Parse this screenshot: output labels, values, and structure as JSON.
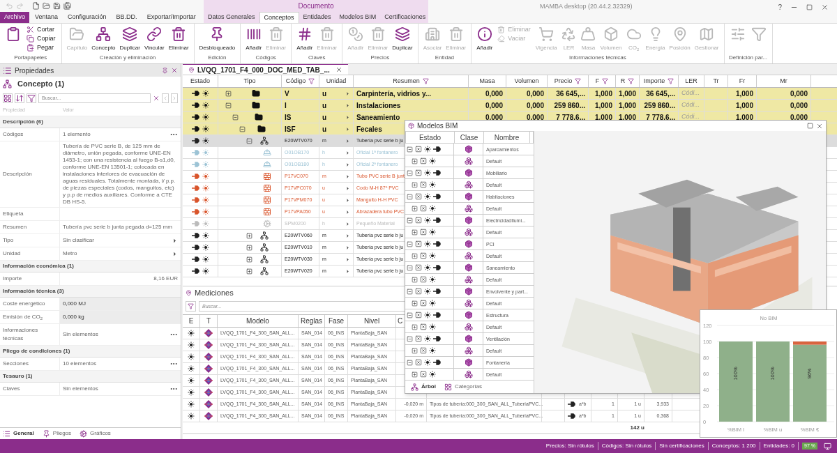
{
  "title_bar": {
    "title": "MAMBA desktop (20.44.2.32329)",
    "help": "?"
  },
  "context_group": {
    "label": "Documento"
  },
  "tabs": [
    {
      "label": "Archivo",
      "kind": "file",
      "selected": false
    },
    {
      "label": "Ventana",
      "kind": "plain",
      "selected": false
    },
    {
      "label": "Configuración",
      "kind": "plain",
      "selected": false
    },
    {
      "label": "BB.DD.",
      "kind": "plain",
      "selected": false
    },
    {
      "label": "Exportar/Importar",
      "kind": "plain",
      "selected": false
    },
    {
      "label": "Datos Generales",
      "kind": "context",
      "selected": false
    },
    {
      "label": "Conceptos",
      "kind": "context",
      "selected": true
    },
    {
      "label": "Entidades",
      "kind": "context",
      "selected": false
    },
    {
      "label": "Modelos BIM",
      "kind": "context",
      "selected": false
    },
    {
      "label": "Certificaciones",
      "kind": "context",
      "selected": false
    }
  ],
  "ribbon": [
    {
      "label": "Portapapeles",
      "buttons": [
        {
          "kind": "icon",
          "disabled": false
        },
        {
          "kind": "small",
          "label": "Cortar",
          "disabled": false
        },
        {
          "kind": "small",
          "label": "Copiar",
          "disabled": false
        },
        {
          "kind": "small",
          "label": "Pegar",
          "disabled": false
        }
      ]
    },
    {
      "label": "Creación y eliminación",
      "buttons": [
        {
          "kind": "large",
          "label": "Capítulo",
          "disabled": true
        },
        {
          "kind": "large",
          "label": "Concepto",
          "disabled": false
        },
        {
          "kind": "large",
          "label": "Duplicar",
          "disabled": false
        },
        {
          "kind": "large",
          "label": "Vincular",
          "disabled": false
        },
        {
          "kind": "large",
          "label": "Eliminar",
          "disabled": false
        }
      ]
    },
    {
      "label": "Edición",
      "buttons": [
        {
          "kind": "large",
          "label": "Desbloqueado",
          "disabled": false
        }
      ]
    },
    {
      "label": "Códigos",
      "buttons": [
        {
          "kind": "large",
          "label": "Añadir",
          "disabled": false
        },
        {
          "kind": "large",
          "label": "Eliminar",
          "disabled": true
        }
      ]
    },
    {
      "label": "Claves",
      "buttons": [
        {
          "kind": "large",
          "label": "Añadir",
          "disabled": false
        },
        {
          "kind": "large",
          "label": "Eliminar",
          "disabled": true
        }
      ]
    },
    {
      "label": "Precios",
      "buttons": [
        {
          "kind": "large",
          "label": "Añadir",
          "disabled": true
        },
        {
          "kind": "large",
          "label": "Eliminar",
          "disabled": true
        },
        {
          "kind": "large",
          "label": "Duplicar",
          "disabled": false
        }
      ]
    },
    {
      "label": "Entidad",
      "buttons": [
        {
          "kind": "large",
          "label": "Asociar",
          "disabled": true
        },
        {
          "kind": "large",
          "label": "Eliminar",
          "disabled": true
        }
      ]
    },
    {
      "label": "Informaciones técnicas",
      "buttons": [
        {
          "kind": "large",
          "label": "Añadir",
          "disabled": false
        },
        {
          "kind": "small",
          "label": "Eliminar",
          "disabled": true
        },
        {
          "kind": "small",
          "label": "Vaciar",
          "disabled": true
        },
        {
          "kind": "large",
          "label": "Vigencia",
          "disabled": true
        },
        {
          "kind": "large",
          "label": "LER",
          "disabled": true
        },
        {
          "kind": "large",
          "label": "Masa",
          "disabled": true
        },
        {
          "kind": "large",
          "label": "Volumen",
          "disabled": true
        },
        {
          "kind": "large",
          "label": "CO$_{2}$",
          "disabled": true
        },
        {
          "kind": "large",
          "label": "Energía",
          "disabled": true
        },
        {
          "kind": "large",
          "label": "Posición",
          "disabled": true
        },
        {
          "kind": "large",
          "label": "Gestionar",
          "disabled": true
        }
      ]
    },
    {
      "label": "Definición par...",
      "buttons": [
        {
          "kind": "icon",
          "disabled": true
        },
        {
          "kind": "icon",
          "disabled": true
        }
      ]
    }
  ],
  "properties_panel": {
    "title": "Propiedades",
    "concept": "Concepto (1)",
    "search_placeholder": "Buscar...",
    "columns": [
      "Propiedad",
      "Valor"
    ],
    "sections": [
      {
        "title": "Descripción (6)",
        "rows": [
          {
            "label": "Códigos",
            "value": "1 elemento",
            "kind": "list"
          },
          {
            "label": "Descripción",
            "value": "Tubería de PVC serie B, de 125 mm de diámetro, unión pegada, conforme UNE-EN 1453-1; con una resistencia al fuego B-s1,d0, conforme UNE-EN 13501-1; colocada en instalaciones interiores de evacuación de aguas residuales. Totalmente montada, i/ p.p. de piezas especiales (codos, manguitos, etc) y p.p de medios auxiliares. Conforme a CTE DB HS-5.",
            "kind": "text"
          },
          {
            "label": "Etiqueta",
            "kind": "text"
          },
          {
            "label": "Resumen",
            "value": "Tubería pvc serie b junta pegada d=125 mm",
            "kind": "text"
          },
          {
            "label": "Tipo",
            "value": "Sin clasificar",
            "kind": "choice"
          },
          {
            "label": "Unidad",
            "value": "Metro",
            "kind": "choice"
          }
        ]
      },
      {
        "title": "Información económica (1)",
        "rows": [
          {
            "label": "Importe",
            "value": "8,16 EUR",
            "kind": "amount"
          }
        ]
      },
      {
        "title": "Información técnica (3)",
        "rows": [
          {
            "label": "Coste energético",
            "value": "0,000 MJ",
            "kind": "computed"
          },
          {
            "label": "Emisión de CO$_{2}$",
            "value": "0,000 kg",
            "kind": "computed"
          },
          {
            "label": "Informaciones técnicas",
            "value": "Sin elementos",
            "kind": "list"
          }
        ]
      },
      {
        "title": "Pliego de condiciones (1)",
        "rows": [
          {
            "label": "Secciones",
            "value": "10 elementos",
            "kind": "list"
          }
        ]
      },
      {
        "title": "Tesauro (1)",
        "rows": [
          {
            "label": "Claves",
            "value": "Sin elementos",
            "kind": "list"
          }
        ]
      }
    ],
    "tabs": [
      {
        "label": "General",
        "selected": true
      },
      {
        "label": "Pliegos",
        "selected": false
      },
      {
        "label": "Gráficos",
        "selected": false
      }
    ]
  },
  "document_tab": {
    "label": "LVQQ_1701_F4_000_DOC_MED_TAB_..."
  },
  "concepts_table": {
    "columns": [
      {
        "label": "Estado",
        "filter": false
      },
      {
        "label": "Tipo",
        "filter": false
      },
      {
        "label": "Código",
        "filter": true
      },
      {
        "label": "Unidad",
        "filter": false
      },
      {
        "label": "Resumen",
        "filter": true
      },
      {
        "label": "Masa",
        "filter": false
      },
      {
        "label": "Volumen",
        "filter": false
      },
      {
        "label": "Precio",
        "filter": true
      },
      {
        "label": "F",
        "filter": true
      },
      {
        "label": "R",
        "filter": true
      },
      {
        "label": "Importe",
        "filter": true
      },
      {
        "label": "LER",
        "filter": false
      },
      {
        "label": "Tr",
        "filter": false
      },
      {
        "label": "Fr",
        "filter": false
      },
      {
        "label": "Mr",
        "filter": false
      }
    ],
    "rows": [
      {
        "kind": "chapter",
        "selected": false,
        "expanded": false,
        "code": "V",
        "unit": "u",
        "summary": "Carpintería, vidrios y...",
        "masa": "0,000",
        "volumen": "0,000",
        "precio": "36 645,...",
        "f": "1,000",
        "r": "1,000",
        "importe": "36 645,...",
        "ler": "Códi...",
        "fr": "1,000",
        "mr": "0,000"
      },
      {
        "kind": "chapter",
        "selected": false,
        "expanded": true,
        "code": "I",
        "unit": "u",
        "summary": "Instalaciones",
        "masa": "0,000",
        "volumen": "0,000",
        "precio": "259 860...",
        "f": "1,000",
        "r": "1,000",
        "importe": "259 860...",
        "ler": "Códi...",
        "fr": "1,000",
        "mr": "0,000",
        "children": [
          {
            "kind": "chapter",
            "selected": false,
            "expanded": true,
            "code": "IS",
            "unit": "u",
            "summary": "Saneamiento",
            "masa": "0,000",
            "volumen": "0,000",
            "precio": "7 778,6...",
            "f": "1,000",
            "r": "1,000",
            "importe": "7 778,6...",
            "ler": "Códi...",
            "fr": "1,000",
            "mr": "0,000",
            "children": [
              {
                "kind": "chapter",
                "selected": false,
                "expanded": true,
                "code": "ISF",
                "unit": "u",
                "summary": "Fecales",
                "children": [
                  {
                    "kind": "item",
                    "selected": true,
                    "expanded": true,
                    "code": "E20WTV070",
                    "unit": "m",
                    "summary": "Tubería pvc serie b ju",
                    "children": [
                      {
                        "kind": "labour",
                        "selected": false,
                        "code": "O01OB170",
                        "unit": "h",
                        "summary": "Oficial 1ª fontanero"
                      },
                      {
                        "kind": "labour",
                        "selected": false,
                        "code": "O01OB180",
                        "unit": "h",
                        "summary": "Oficial 2ª fontanero"
                      },
                      {
                        "kind": "material",
                        "selected": false,
                        "code": "P17VC070",
                        "unit": "m",
                        "summary": "Tubo PVC serie B junt"
                      },
                      {
                        "kind": "material",
                        "selected": false,
                        "code": "P17VPC070",
                        "unit": "u",
                        "summary": "Codo M-H 87º PVC"
                      },
                      {
                        "kind": "material",
                        "selected": false,
                        "code": "P17VPM070",
                        "unit": "u",
                        "summary": "Manguito H-H PVC"
                      },
                      {
                        "kind": "material",
                        "selected": false,
                        "code": "P17VPA050",
                        "unit": "u",
                        "summary": "Abrazadera tubo PVC"
                      },
                      {
                        "kind": "other",
                        "selected": false,
                        "code": "SPM0200",
                        "unit": "h",
                        "summary": "Pequeño Material"
                      }
                    ]
                  },
                  {
                    "kind": "item",
                    "selected": false,
                    "expanded": false,
                    "code": "E20WTV060",
                    "unit": "m",
                    "summary": "Tubería pvc serie b ju"
                  },
                  {
                    "kind": "item",
                    "selected": false,
                    "expanded": false,
                    "code": "E20WTV010",
                    "unit": "m",
                    "summary": "Tubería pvc serie b ju"
                  },
                  {
                    "kind": "item",
                    "selected": false,
                    "expanded": false,
                    "code": "E20WTV030",
                    "unit": "m",
                    "summary": "Tubería pvc serie b ju"
                  },
                  {
                    "kind": "item",
                    "selected": false,
                    "expanded": false,
                    "code": "E20WTV020",
                    "unit": "m",
                    "summary": "Tubería pvc serie b ju"
                  }
                ]
              }
            ]
          }
        ]
      }
    ]
  },
  "mediciones": {
    "title": "Mediciones",
    "search_placeholder": "Buscar...",
    "columns": [
      "E",
      "T",
      "Modelo",
      "Reglas",
      "Fase",
      "Nivel",
      "C"
    ],
    "rows": [
      {
        "modelo": "LVQQ_1701_F4_300_SAN_ALL...",
        "reglas": "SAN_014",
        "fase": "06_INS",
        "nivel": "PlantaBaja_SAN"
      },
      {
        "modelo": "LVQQ_1701_F4_300_SAN_ALL...",
        "reglas": "SAN_014",
        "fase": "06_INS",
        "nivel": "PlantaBaja_SAN"
      },
      {
        "modelo": "LVQQ_1701_F4_300_SAN_ALL...",
        "reglas": "SAN_014",
        "fase": "06_INS",
        "nivel": "PlantaBaja_SAN"
      },
      {
        "modelo": "LVQQ_1701_F4_300_SAN_ALL...",
        "reglas": "SAN_014",
        "fase": "06_INS",
        "nivel": "PlantaBaja_SAN"
      },
      {
        "modelo": "LVQQ_1701_F4_300_SAN_ALL...",
        "reglas": "SAN_014",
        "fase": "06_INS",
        "nivel": "PlantaBaja_SAN"
      },
      {
        "modelo": "LVQQ_1701_F4_300_SAN_ALL...",
        "reglas": "SAN_014",
        "fase": "06_INS",
        "nivel": "PlantaBaja_SAN"
      },
      {
        "modelo": "LVQQ_1701_F4_300_SAN_ALL...",
        "reglas": "SAN_014",
        "fase": "06_INS",
        "nivel": "PlantaBaja_SAN",
        "c": "-0,020 m",
        "column_8": "Tipos de tubería:000_300_SAN_ALL_TuberíaPVC...",
        "column_10": "a*b",
        "column_11": "1",
        "column_12": "1 u",
        "column_13": "3,933"
      },
      {
        "modelo": "LVQQ_1701_F4_300_SAN_ALL...",
        "reglas": "SAN_014",
        "fase": "06_INS",
        "nivel": "PlantaBaja_SAN",
        "c": "-0,020 m",
        "column_8": "Tipos de tubería:000_300_SAN_ALL_TuberíaPVC...",
        "column_10": "a*b",
        "column_11": "1",
        "column_12": "1 u",
        "column_13": "0,368"
      }
    ],
    "total": "142 u"
  },
  "bim_window": {
    "title": "Modelos BIM",
    "columns": [
      "Estado",
      "Clase",
      "Nombre"
    ],
    "models": [
      {
        "name": "Aparcamientos",
        "expanded": true,
        "children": [
          {
            "name": "Default",
            "expanded": false
          }
        ]
      },
      {
        "name": "Mobiliario",
        "expanded": true,
        "children": [
          {
            "name": "Default",
            "expanded": false
          }
        ]
      },
      {
        "name": "Habitaciones",
        "expanded": true,
        "children": [
          {
            "name": "Default",
            "expanded": false
          }
        ]
      },
      {
        "name": "ElectricidadIlumi...",
        "expanded": true,
        "children": [
          {
            "name": "Default",
            "expanded": false
          }
        ]
      },
      {
        "name": "PCI",
        "expanded": true,
        "children": [
          {
            "name": "Default",
            "expanded": false
          }
        ]
      },
      {
        "name": "Saneamiento",
        "expanded": true,
        "children": [
          {
            "name": "Default",
            "expanded": false
          }
        ]
      },
      {
        "name": "Envolvente y part...",
        "expanded": true,
        "children": [
          {
            "name": "Default",
            "expanded": false
          }
        ]
      },
      {
        "name": "Estructura",
        "expanded": true,
        "children": [
          {
            "name": "Default",
            "expanded": false
          }
        ]
      },
      {
        "name": "Ventilación",
        "expanded": true,
        "children": [
          {
            "name": "Default",
            "expanded": false
          }
        ]
      },
      {
        "name": "Fontanería",
        "expanded": true,
        "children": [
          {
            "name": "Default",
            "expanded": false
          }
        ]
      }
    ],
    "tabs": [
      {
        "label": "Árbol",
        "selected": true
      },
      {
        "label": "Categorías",
        "selected": false
      }
    ],
    "viewer": {
      "kind": "picture"
    }
  },
  "chart_panel": {
    "chart_data": {
      "type": "bar",
      "stacked": true,
      "grid": true,
      "categories": [
        "%BIM l",
        "%BIM u",
        "%BIM €"
      ],
      "ylim": [
        0,
        120
      ],
      "yticks": [
        0,
        20,
        40,
        60,
        80,
        100,
        120
      ],
      "series": [
        {
          "color": "#8fb08a",
          "values": [
            100,
            100,
            96
          ]
        },
        {
          "name": "No BIM",
          "color": "#d9643f",
          "values": [
            0,
            0,
            4
          ]
        }
      ],
      "value_labels": [
        "100%",
        "100%",
        "96%"
      ]
    }
  },
  "status_bar": {
    "items": [
      "Precios: Sin rótulos",
      "Códigos: Sin rótulos",
      "Sin certificaciones",
      "Conceptos: 1 200",
      "Entidades: 0"
    ],
    "zoom": "97 %"
  }
}
